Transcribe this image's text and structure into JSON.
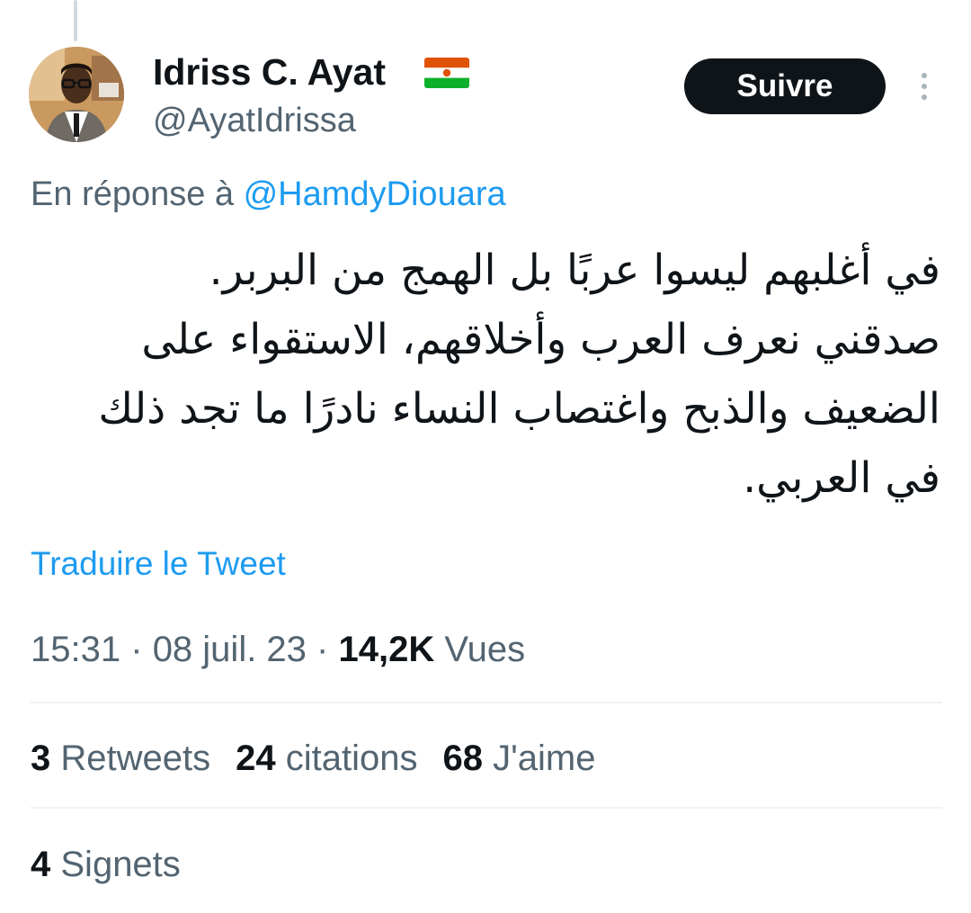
{
  "author": {
    "display_name": "Idriss C. Ayat",
    "handle": "@AyatIdrissa",
    "flag_icon": "flag-niger-icon",
    "flag_colors": [
      "#e05206",
      "#ffffff",
      "#0db02b"
    ],
    "avatar_icon": "profile-photo"
  },
  "follow_label": "Suivre",
  "more_icon": "more-vertical-icon",
  "reply": {
    "prefix": "En réponse à ",
    "mention": "@HamdyDiouara"
  },
  "tweet": {
    "lines": [
      "في أغلبهم ليسوا عربًا بل الهمج من البربر.",
      "صدقني نعرف العرب وأخلاقهم، الاستقواء على",
      "الضعيف والذبح واغتصاب النساء نادرًا ما تجد ذلك",
      "في العربي."
    ]
  },
  "translate_label": "Traduire le Tweet",
  "meta": {
    "time": "15:31",
    "separator": "·",
    "date": "08 juil. 23",
    "views_count": "14,2K",
    "views_label": "Vues"
  },
  "stats": [
    {
      "count": "3",
      "label": "Retweets"
    },
    {
      "count": "24",
      "label": "citations"
    },
    {
      "count": "68",
      "label": "J'aime"
    }
  ],
  "bookmarks": {
    "count": "4",
    "label": "Signets"
  },
  "colors": {
    "text_primary": "#0f1419",
    "text_secondary": "#536471",
    "accent": "#1d9bf0",
    "divider": "#eff3f4",
    "button_bg": "#0f1419"
  }
}
